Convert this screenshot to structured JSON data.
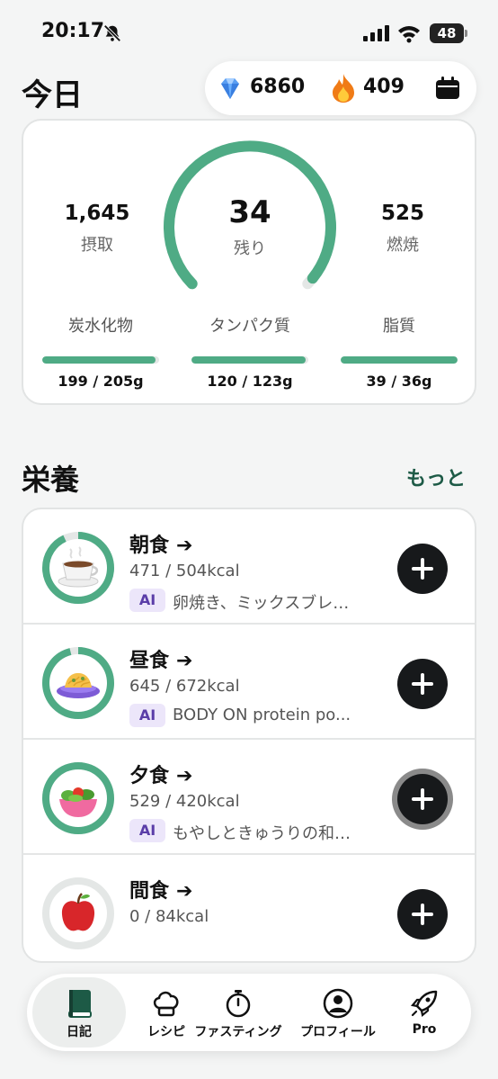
{
  "status": {
    "time": "20:17",
    "battery": "48"
  },
  "header": {
    "title": "今日",
    "gems": "6860",
    "streak": "409"
  },
  "summary": {
    "intake": {
      "value": "1,645",
      "label": "摂取"
    },
    "remaining": {
      "value": "34",
      "label": "残り"
    },
    "burned": {
      "value": "525",
      "label": "燃焼"
    },
    "ring_progress": 0.98,
    "macros": [
      {
        "label": "炭水化物",
        "value": "199 / 205g",
        "progress": 0.97
      },
      {
        "label": "タンパク質",
        "value": "120 / 123g",
        "progress": 0.98
      },
      {
        "label": "脂質",
        "value": "39 / 36g",
        "progress": 1.0
      }
    ]
  },
  "nutrition": {
    "title": "栄養",
    "more_label": "もっと",
    "meals": [
      {
        "name": "朝食",
        "kcal": "471 / 504kcal",
        "ai_badge": "AI",
        "desc": "卵焼き、ミックスブレ…",
        "progress": 0.93
      },
      {
        "name": "昼食",
        "kcal": "645 / 672kcal",
        "ai_badge": "AI",
        "desc": "BODY ON  protein po...",
        "progress": 0.96
      },
      {
        "name": "夕食",
        "kcal": "529 / 420kcal",
        "ai_badge": "AI",
        "desc": "もやしときゅうりの和…",
        "progress": 1.0
      },
      {
        "name": "間食",
        "kcal": "0 / 84kcal",
        "ai_badge": "",
        "desc": "",
        "progress": 0.0
      }
    ]
  },
  "tabs": [
    {
      "label": "日記",
      "icon": "book-icon",
      "active": true
    },
    {
      "label": "レシピ",
      "icon": "chef-hat-icon",
      "active": false
    },
    {
      "label": "ファスティング",
      "icon": "stopwatch-icon",
      "active": false
    },
    {
      "label": "プロフィール",
      "icon": "user-icon",
      "active": false
    },
    {
      "label": "Pro",
      "icon": "rocket-icon",
      "active": false
    }
  ],
  "colors": {
    "accent": "#4fab85",
    "track": "#e4e7e6",
    "link": "#1d5a46",
    "ai_bg": "#ece6fa",
    "ai_text": "#5a3da8"
  }
}
